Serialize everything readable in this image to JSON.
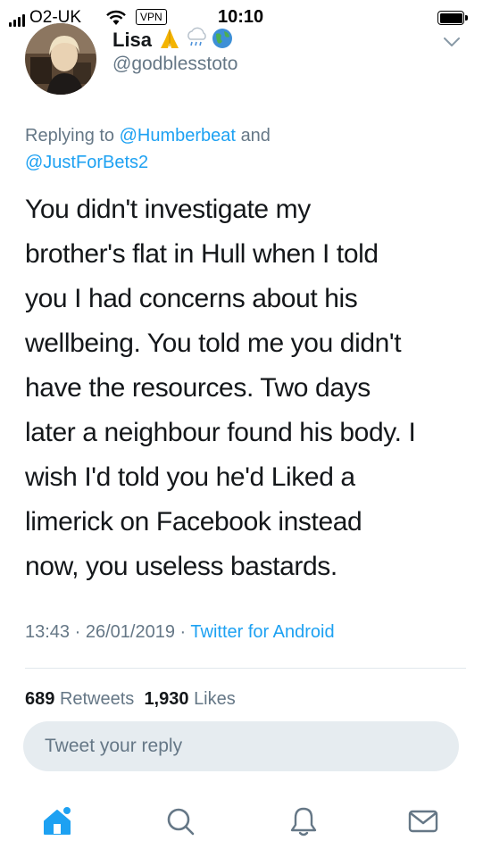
{
  "status_bar": {
    "carrier": "O2-UK",
    "vpn_label": "VPN",
    "time": "10:10"
  },
  "tweet": {
    "author_name": "Lisa",
    "author_handle": "@godblesstoto",
    "name_emoji": [
      "folded-hands-emoji",
      "rain-cloud-emoji",
      "globe-emoji"
    ],
    "replying_prefix": "Replying to",
    "replying_to_1": "@Humberbeat",
    "replying_and": "and",
    "replying_to_2": "@JustForBets2",
    "text_lines": [
      "You didn't investigate my",
      "brother's flat in Hull when I told",
      "you I had concerns about his",
      "wellbeing. You told me you didn't",
      "have the resources. Two days",
      "later a neighbour found his body. I",
      "wish I'd told you he'd Liked a",
      "limerick on Facebook instead",
      "now, you useless bastards."
    ],
    "time": "13:43",
    "date": "26/01/2019",
    "separator": "·",
    "source": "Twitter for Android",
    "retweets_count": "689",
    "retweets_label": "Retweets",
    "likes_count": "1,930",
    "likes_label": "Likes"
  },
  "reply_box": {
    "placeholder": "Tweet your reply"
  },
  "tabbar": {
    "icons": [
      "home-icon",
      "search-icon",
      "notifications-icon",
      "messages-icon"
    ],
    "accent": "#1da1f2",
    "inactive": "#657786"
  },
  "colors": {
    "link": "#1da1f2",
    "secondary_text": "#657786",
    "primary_text": "#14171a",
    "reply_box_bg": "#e6ecf0"
  }
}
